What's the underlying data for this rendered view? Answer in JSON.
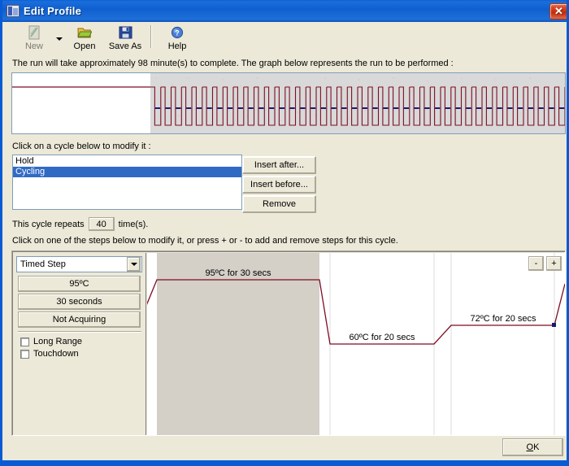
{
  "window": {
    "title": "Edit Profile",
    "title_icon": "profile-document-icon",
    "close_label": "✕"
  },
  "toolbar": {
    "items": [
      {
        "label": "New",
        "icon": "new-document-icon",
        "disabled": true
      },
      {
        "label": "Open",
        "icon": "open-folder-icon",
        "disabled": false
      },
      {
        "label": "Save As",
        "icon": "floppy-disk-icon",
        "disabled": false
      },
      {
        "label": "Help",
        "icon": "help-question-icon",
        "disabled": false
      }
    ],
    "dropdown_icon": "chevron-down-icon"
  },
  "info": {
    "text": "The run will take approximately 98 minute(s) to complete. The graph below represents the run to be performed :",
    "minutes": 98
  },
  "cycles": {
    "prompt": "Click on a cycle below to modify it :",
    "items": [
      {
        "label": "Hold",
        "selected": false
      },
      {
        "label": "Cycling",
        "selected": true
      }
    ],
    "buttons": {
      "insert_after": "Insert after...",
      "insert_before": "Insert before...",
      "remove": "Remove"
    },
    "repeats_prefix": "This cycle repeats",
    "repeats_value": "40",
    "repeats_suffix": "time(s)."
  },
  "steps": {
    "prompt": "Click on one of the steps below to modify it, or press + or - to add and remove steps for this cycle.",
    "editor": {
      "step_type": "Timed Step",
      "temperature": "95ºC",
      "duration": "30 seconds",
      "acquisition": "Not Acquiring",
      "long_range_label": "Long Range",
      "long_range_checked": false,
      "touchdown_label": "Touchdown",
      "touchdown_checked": false
    },
    "minus_label": "-",
    "plus_label": "+"
  },
  "footer": {
    "ok_label": "OK",
    "ok_accel": "O"
  },
  "colors": {
    "trace": "#7d0d22",
    "acquire_marker": "#1a1a6e",
    "selection": "#316ac5",
    "face": "#ece9d8",
    "selected_step_fill": "#d4d0c8",
    "titlebar": "#0a5ad4"
  },
  "chart_data": [
    {
      "type": "line",
      "name": "run-profile-overview",
      "title": "",
      "xlabel": "",
      "ylabel": "",
      "grid": false,
      "legend": null,
      "regions": [
        {
          "name": "Hold",
          "x_start": 0,
          "x_end": 0.25,
          "shaded": false
        },
        {
          "name": "Cycling",
          "x_start": 0.25,
          "x_end": 1.0,
          "shaded": true
        }
      ],
      "hold_level": 95,
      "cycle_count": 40,
      "cycle_levels": {
        "denature": 95,
        "anneal": 60,
        "extend": 72
      },
      "acquire_level": 72,
      "annotations": []
    },
    {
      "type": "line",
      "name": "cycle-step-detail",
      "title": "",
      "xlabel": "",
      "ylabel": "",
      "grid": false,
      "legend": null,
      "ylim": [
        55,
        100
      ],
      "steps": [
        {
          "index": 1,
          "temperature_c": 95,
          "duration_s": 30,
          "label": "95ºC for 30 secs",
          "selected": true,
          "acquiring": false
        },
        {
          "index": 2,
          "temperature_c": 60,
          "duration_s": 20,
          "label": "60ºC for 20 secs",
          "selected": false,
          "acquiring": false
        },
        {
          "index": 3,
          "temperature_c": 72,
          "duration_s": 20,
          "label": "72ºC for 20 secs",
          "selected": false,
          "acquiring": true
        }
      ]
    }
  ]
}
